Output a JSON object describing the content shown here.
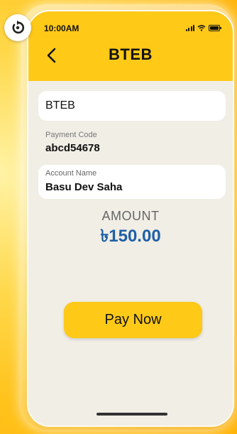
{
  "status_bar": {
    "time": "10:00AM"
  },
  "header": {
    "title": "BTEB"
  },
  "biller_field": {
    "value": "BTEB"
  },
  "payment_code": {
    "label": "Payment Code",
    "value": "abcd54678"
  },
  "account_name": {
    "label": "Account Name",
    "value": "Basu Dev Saha"
  },
  "amount": {
    "label": "AMOUNT",
    "value": "৳150.00"
  },
  "actions": {
    "pay_label": "Pay Now"
  },
  "colors": {
    "accent": "#ffc918",
    "amount": "#1f5fa6",
    "background": "#f1eee6"
  }
}
